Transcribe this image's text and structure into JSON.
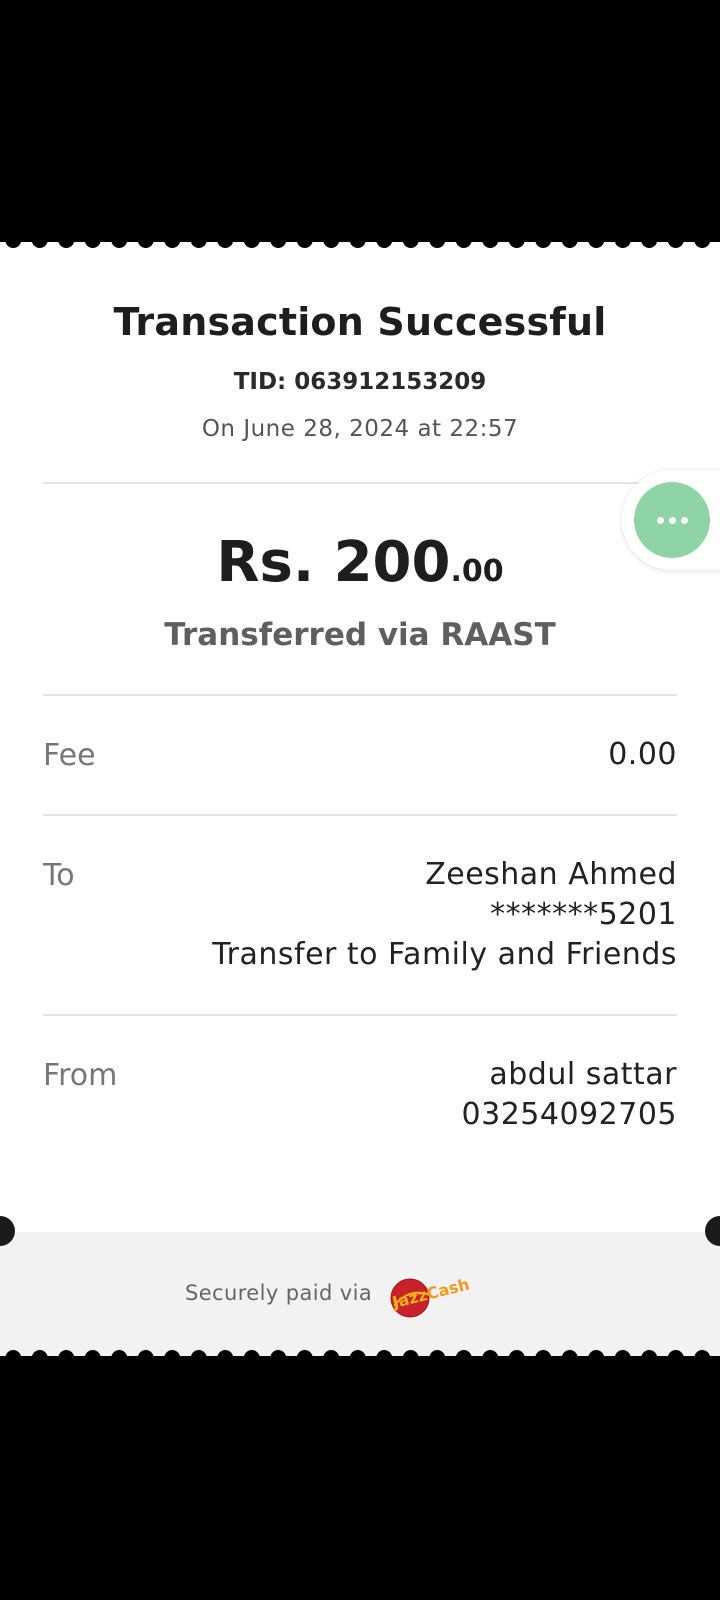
{
  "receipt": {
    "title": "Transaction Successful",
    "tid": "TID: 063912153209",
    "date": "On June 28, 2024 at 22:57",
    "amount_main": "Rs. 200",
    "amount_cents": ".00",
    "transfer_method": "Transferred via RAAST",
    "fee": {
      "label": "Fee",
      "value": "0.00"
    },
    "to": {
      "label": "To",
      "name": "Zeeshan Ahmed",
      "account": "*******5201",
      "purpose": "Transfer to Family and Friends"
    },
    "from": {
      "label": "From",
      "name": "abdul sattar",
      "number": "03254092705"
    }
  },
  "footer": {
    "text": "Securely paid via",
    "logo_text": "JazzCash",
    "logo_icon": "jazzcash-logo"
  },
  "fab": {
    "icon": "more-horizontal-icon",
    "color": "#8fd4a6"
  }
}
